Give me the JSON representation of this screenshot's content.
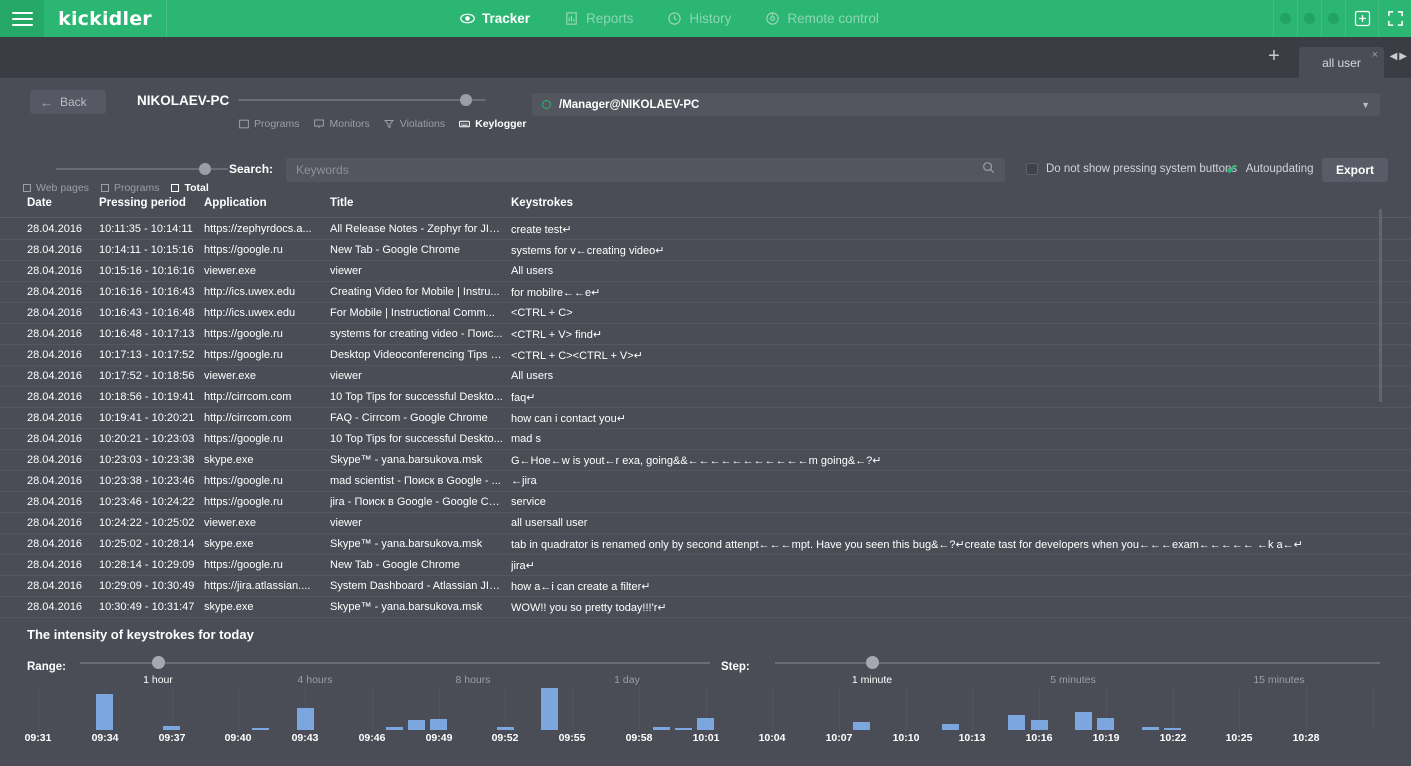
{
  "topbar": {
    "brand": "kickidler",
    "menu_icon": "hamburger-icon",
    "nav": [
      {
        "label": "Tracker",
        "icon": "eye-icon",
        "active": true
      },
      {
        "label": "Reports",
        "icon": "report-icon",
        "active": false
      },
      {
        "label": "History",
        "icon": "history-clock-icon",
        "active": false
      },
      {
        "label": "Remote control",
        "icon": "remote-control-icon",
        "active": false
      }
    ],
    "status_dots": 3,
    "add_panel_icon": "add-panel-icon",
    "fullscreen_icon": "fullscreen-icon"
  },
  "tabstrip": {
    "add_tab_label": "+",
    "tab_label": "all user",
    "close_label": "×",
    "prev_label": "◀",
    "next_label": "▶"
  },
  "header": {
    "back_label": "Back",
    "back_arrow": "←",
    "hostname": "NIKOLAEV-PC",
    "modes": [
      {
        "label": "Programs",
        "icon": "window-icon",
        "active": false
      },
      {
        "label": "Monitors",
        "icon": "monitor-icon",
        "active": false
      },
      {
        "label": "Violations",
        "icon": "funnel-icon",
        "active": false
      },
      {
        "label": "Keylogger",
        "icon": "keyboard-icon",
        "active": true
      }
    ],
    "dropdown_value": "/Manager@NIKOLAEV-PC",
    "dropdown_caret": "▼"
  },
  "filters": {
    "types": [
      {
        "label": "Web pages",
        "active": false
      },
      {
        "label": "Programs",
        "active": false
      },
      {
        "label": "Total",
        "active": true
      }
    ],
    "search_label": "Search:",
    "search_placeholder": "Keywords",
    "search_value": "",
    "search_icon": "magnifier-icon",
    "hide_system_buttons_label": "Do not show pressing system buttons",
    "hide_system_buttons_checked": false,
    "autoupdating_label": "Autoupdating",
    "autoupdating_checked": true,
    "autoupdating_check_glyph": "✔",
    "export_label": "Export"
  },
  "table": {
    "columns": [
      "Date",
      "Pressing period",
      "Application",
      "Title",
      "Keystrokes"
    ],
    "rows": [
      {
        "date": "28.04.2016",
        "period": "10:11:35 - 10:14:11",
        "app": "https://zephyrdocs.a...",
        "title": "All Release Notes - Zephyr for JIR...",
        "keys": "create test↵"
      },
      {
        "date": "28.04.2016",
        "period": "10:14:11 - 10:15:16",
        "app": "https://google.ru",
        "title": "New Tab - Google Chrome",
        "keys": "systems for v←creating video↵"
      },
      {
        "date": "28.04.2016",
        "period": "10:15:16 - 10:16:16",
        "app": "viewer.exe",
        "title": "viewer",
        "keys": "All users"
      },
      {
        "date": "28.04.2016",
        "period": "10:16:16 - 10:16:43",
        "app": "http://ics.uwex.edu",
        "title": "Creating Video for Mobile | Instru...",
        "keys": "for mobilre←←e↵"
      },
      {
        "date": "28.04.2016",
        "period": "10:16:43 - 10:16:48",
        "app": "http://ics.uwex.edu",
        "title": "For Mobile | Instructional Comm...",
        "keys": "<CTRL + C>"
      },
      {
        "date": "28.04.2016",
        "period": "10:16:48 - 10:17:13",
        "app": "https://google.ru",
        "title": "systems for creating video - Поис...",
        "keys": "<CTRL + V> find↵"
      },
      {
        "date": "28.04.2016",
        "period": "10:17:13 - 10:17:52",
        "app": "https://google.ru",
        "title": "Desktop Videoconferencing Tips fi...",
        "keys": "<CTRL + C><CTRL + V>↵"
      },
      {
        "date": "28.04.2016",
        "period": "10:17:52 - 10:18:56",
        "app": "viewer.exe",
        "title": "viewer",
        "keys": "All users"
      },
      {
        "date": "28.04.2016",
        "period": "10:18:56 - 10:19:41",
        "app": "http://cirrcom.com",
        "title": "10 Top Tips for successful Deskto...",
        "keys": "faq↵"
      },
      {
        "date": "28.04.2016",
        "period": "10:19:41 - 10:20:21",
        "app": "http://cirrcom.com",
        "title": "FAQ - Cirrcom - Google Chrome",
        "keys": "how can i contact you↵"
      },
      {
        "date": "28.04.2016",
        "period": "10:20:21 - 10:23:03",
        "app": "https://google.ru",
        "title": "10 Top Tips for successful Deskto...",
        "keys": "mad s"
      },
      {
        "date": "28.04.2016",
        "period": "10:23:03 - 10:23:38",
        "app": "skype.exe",
        "title": "Skype™ - yana.barsukova.msk",
        "keys": "G←Hoe←w is yout←r exa, going&&←←←←←←←←←←←m going&←?↵"
      },
      {
        "date": "28.04.2016",
        "period": "10:23:38 - 10:23:46",
        "app": "https://google.ru",
        "title": "mad scientist - Поиск в Google - ...",
        "keys": "←jira"
      },
      {
        "date": "28.04.2016",
        "period": "10:23:46 - 10:24:22",
        "app": "https://google.ru",
        "title": "jira - Поиск в Google - Google Chr...",
        "keys": " service"
      },
      {
        "date": "28.04.2016",
        "period": "10:24:22 - 10:25:02",
        "app": "viewer.exe",
        "title": "viewer",
        "keys": "all usersall user"
      },
      {
        "date": "28.04.2016",
        "period": "10:25:02 - 10:28:14",
        "app": "skype.exe",
        "title": "Skype™ - yana.barsukova.msk",
        "keys": "tab in quadrator is renamed only by second attenpt←←←mpt. Have you seen this bug&←?↵create tast for developers when you←←←exam←←←←← ←k a←↵"
      },
      {
        "date": "28.04.2016",
        "period": "10:28:14 - 10:29:09",
        "app": "https://google.ru",
        "title": "New Tab - Google Chrome",
        "keys": "jira↵"
      },
      {
        "date": "28.04.2016",
        "period": "10:29:09 - 10:30:49",
        "app": "https://jira.atlassian....",
        "title": "System Dashboard - Atlassian JIR...",
        "keys": "how a←i can create a filter↵"
      },
      {
        "date": "28.04.2016",
        "period": "10:30:49 - 10:31:47",
        "app": "skype.exe",
        "title": "Skype™ - yana.barsukova.msk",
        "keys": "WOW!! you so pretty today!!!'r↵"
      }
    ]
  },
  "chart_section": {
    "title": "The intensity of keystrokes for today",
    "range_label": "Range:",
    "range_options": [
      {
        "label": "1 hour",
        "active": true
      },
      {
        "label": "4 hours",
        "active": false
      },
      {
        "label": "8 hours",
        "active": false
      },
      {
        "label": "1 day",
        "active": false
      }
    ],
    "range_selected": "1 hour",
    "step_label": "Step:",
    "step_options": [
      {
        "label": "1 minute",
        "active": true
      },
      {
        "label": "5 minutes",
        "active": false
      },
      {
        "label": "15 minutes",
        "active": false
      }
    ],
    "step_selected": "1 minute"
  },
  "chart_data": {
    "type": "bar",
    "title": "The intensity of keystrokes for today",
    "xlabel": "",
    "ylabel": "",
    "grid": true,
    "legend": null,
    "bar_color": "#7ba7de",
    "x_tick_labels": [
      "09:31",
      "09:34",
      "09:37",
      "09:40",
      "09:43",
      "09:46",
      "09:49",
      "09:52",
      "09:55",
      "09:58",
      "10:01",
      "10:04",
      "10:07",
      "10:10",
      "10:13",
      "10:16",
      "10:19",
      "10:22",
      "10:25",
      "10:28"
    ],
    "x_tick_interval_minutes": 3,
    "categories": [
      "09:31",
      "09:32",
      "09:33",
      "09:34",
      "09:35",
      "09:36",
      "09:37",
      "09:38",
      "09:39",
      "09:40",
      "09:41",
      "09:42",
      "09:43",
      "09:44",
      "09:45",
      "09:46",
      "09:47",
      "09:48",
      "09:49",
      "09:50",
      "09:51",
      "09:52",
      "09:53",
      "09:54",
      "09:55",
      "09:56",
      "09:57",
      "09:58",
      "09:59",
      "10:00",
      "10:01",
      "10:02",
      "10:03",
      "10:04",
      "10:05",
      "10:06",
      "10:07",
      "10:08",
      "10:09",
      "10:10",
      "10:11",
      "10:12",
      "10:13",
      "10:14",
      "10:15",
      "10:16",
      "10:17",
      "10:18",
      "10:19",
      "10:20",
      "10:21",
      "10:22",
      "10:23",
      "10:24",
      "10:25",
      "10:26",
      "10:27",
      "10:28",
      "10:29",
      "10:30",
      "10:31"
    ],
    "values": [
      0,
      0,
      0,
      36,
      0,
      0,
      4,
      0,
      0,
      0,
      2,
      0,
      22,
      0,
      0,
      0,
      3,
      10,
      11,
      0,
      0,
      3,
      0,
      42,
      0,
      0,
      0,
      0,
      3,
      1,
      12,
      0,
      0,
      0,
      0,
      0,
      0,
      8,
      0,
      0,
      0,
      6,
      0,
      0,
      15,
      10,
      0,
      18,
      12,
      0,
      3,
      1,
      0,
      0,
      0,
      0,
      0,
      0,
      0,
      0,
      0
    ],
    "ylim": [
      0,
      44
    ],
    "notes": "Bar heights read in pixels off the plot; y-axis is unlabeled keystroke intensity."
  }
}
